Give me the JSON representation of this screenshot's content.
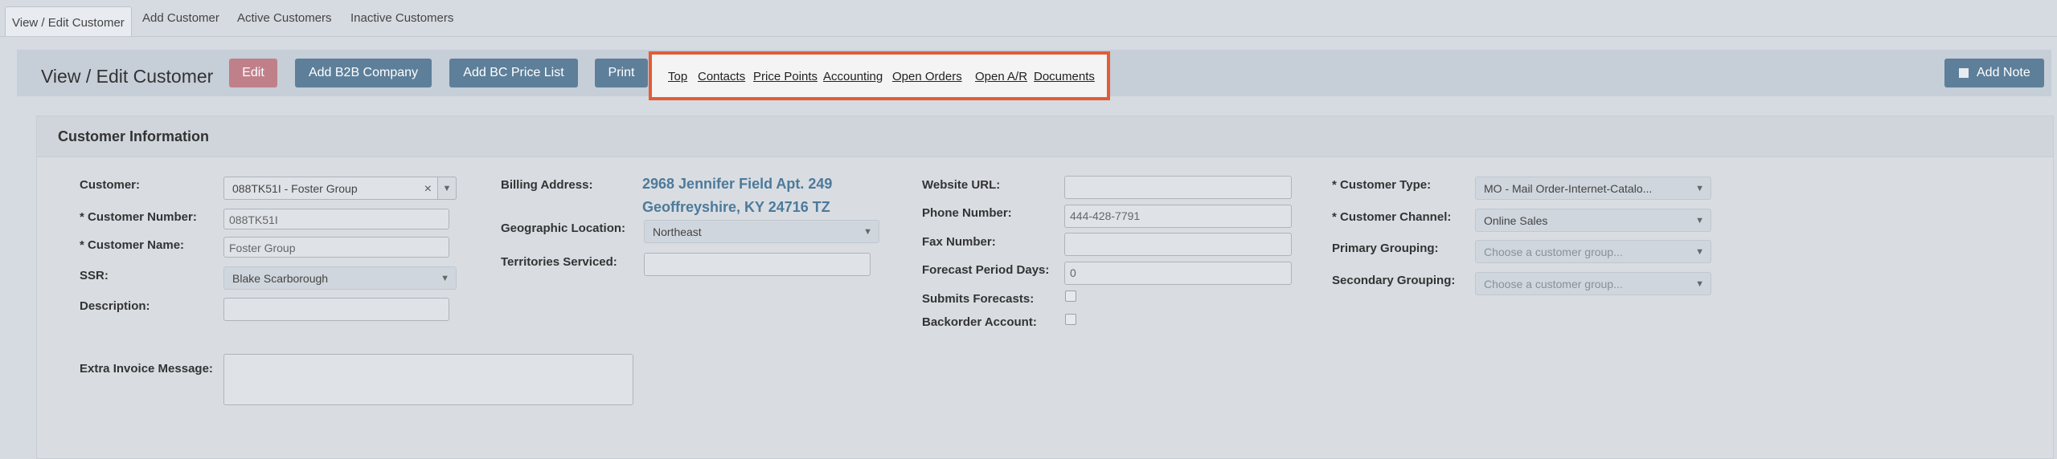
{
  "tabs": [
    "View / Edit Customer",
    "Add Customer",
    "Active Customers",
    "Inactive Customers"
  ],
  "header": {
    "title": "View / Edit Customer",
    "buttons": {
      "edit": "Edit",
      "add_b2b": "Add B2B Company",
      "add_bc": "Add BC Price List",
      "print": "Print",
      "add_note": "Add Note"
    },
    "anchors": [
      "Top",
      "Contacts",
      "Price Points",
      "Accounting",
      "Open Orders",
      "Open A/R",
      "Documents"
    ]
  },
  "panel": {
    "title": "Customer Information",
    "col1": {
      "customer_label": "Customer:",
      "customer_value": "088TK51I - Foster Group",
      "customer_number_label": "* Customer Number:",
      "customer_number_value": "088TK51I",
      "customer_name_label": "* Customer Name:",
      "customer_name_value": "Foster Group",
      "ssr_label": "SSR:",
      "ssr_value": "Blake Scarborough",
      "description_label": "Description:",
      "description_value": "",
      "extra_invoice_label": "Extra Invoice Message:",
      "extra_invoice_value": ""
    },
    "col2": {
      "billing_label": "Billing Address:",
      "billing_line1": "2968 Jennifer Field Apt. 249",
      "billing_line2": "Geoffreyshire, KY 24716 TZ",
      "geo_label": "Geographic Location:",
      "geo_value": "Northeast",
      "territories_label": "Territories Serviced:",
      "territories_value": ""
    },
    "col3": {
      "website_label": "Website URL:",
      "website_value": "",
      "phone_label": "Phone Number:",
      "phone_value": "444-428-7791",
      "fax_label": "Fax Number:",
      "fax_value": "",
      "forecast_label": "Forecast Period Days:",
      "forecast_value": "0",
      "submits_label": "Submits Forecasts:",
      "backorder_label": "Backorder Account:"
    },
    "col4": {
      "type_label": "* Customer Type:",
      "type_value": "MO - Mail Order-Internet-Catalo...",
      "channel_label": "* Customer Channel:",
      "channel_value": "Online Sales",
      "primary_label": "Primary Grouping:",
      "primary_placeholder": "Choose a customer group...",
      "secondary_label": "Secondary Grouping:",
      "secondary_placeholder": "Choose a customer group..."
    }
  }
}
